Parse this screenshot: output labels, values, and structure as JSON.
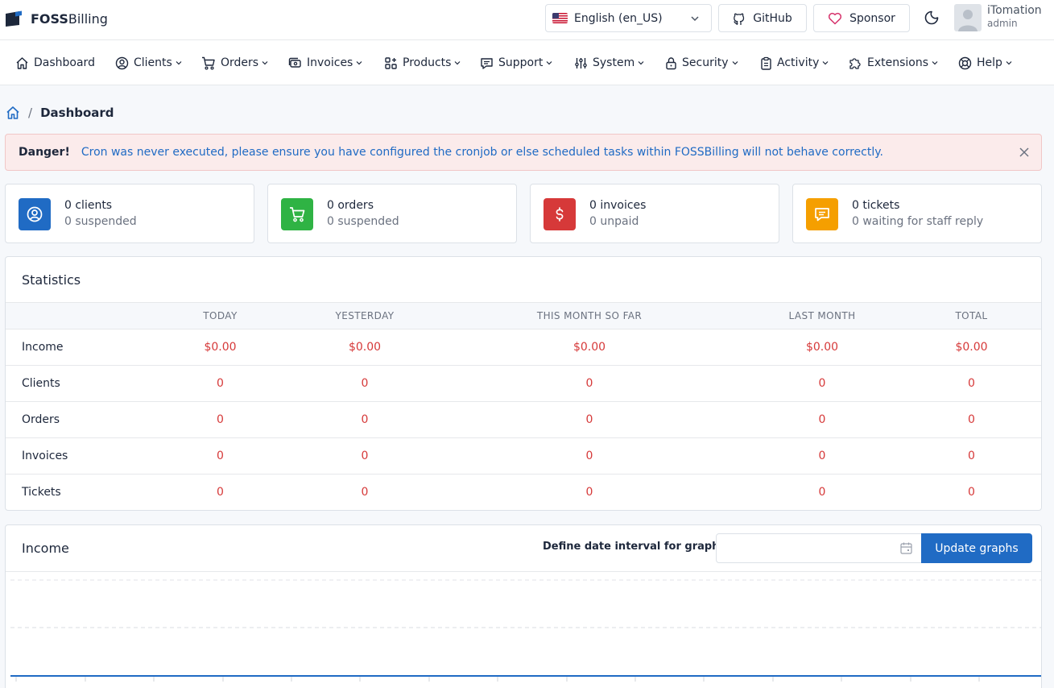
{
  "brand": {
    "bold": "FOSS",
    "rest": "Billing"
  },
  "topbar": {
    "language": "English (en_US)",
    "github_label": "GitHub",
    "sponsor_label": "Sponsor",
    "user_name": "iTomation",
    "user_role": "admin"
  },
  "nav": {
    "items": [
      {
        "label": "Dashboard",
        "icon": "home-icon"
      },
      {
        "label": "Clients",
        "icon": "user-circle-icon"
      },
      {
        "label": "Orders",
        "icon": "cart-icon"
      },
      {
        "label": "Invoices",
        "icon": "invoice-icon"
      },
      {
        "label": "Products",
        "icon": "apps-icon"
      },
      {
        "label": "Support",
        "icon": "message-icon"
      },
      {
        "label": "System",
        "icon": "adjustments-icon"
      },
      {
        "label": "Security",
        "icon": "lock-icon"
      },
      {
        "label": "Activity",
        "icon": "clipboard-icon"
      },
      {
        "label": "Extensions",
        "icon": "puzzle-icon"
      },
      {
        "label": "Help",
        "icon": "lifebuoy-icon"
      }
    ]
  },
  "breadcrumb": {
    "separator": "/",
    "current": "Dashboard"
  },
  "alert": {
    "title": "Danger!",
    "message": "Cron was never executed, please ensure you have configured the cronjob or else scheduled tasks within FOSSBilling will not behave correctly."
  },
  "summary": [
    {
      "line1": "0 clients",
      "line2": "0 suspended",
      "icon": "user-circle-icon",
      "color": "#206bc4"
    },
    {
      "line1": "0 orders",
      "line2": "0 suspended",
      "icon": "cart-icon",
      "color": "#2fb344"
    },
    {
      "line1": "0 invoices",
      "line2": "0 unpaid",
      "icon": "dollar-icon",
      "color": "#d63939"
    },
    {
      "line1": "0 tickets",
      "line2": "0 waiting for staff reply",
      "icon": "message-icon",
      "color": "#f59f00"
    }
  ],
  "statistics": {
    "title": "Statistics",
    "columns": [
      "",
      "Today",
      "Yesterday",
      "This month so far",
      "Last month",
      "Total"
    ],
    "rows": [
      {
        "label": "Income",
        "values": [
          "$0.00",
          "$0.00",
          "$0.00",
          "$0.00",
          "$0.00"
        ]
      },
      {
        "label": "Clients",
        "values": [
          "0",
          "0",
          "0",
          "0",
          "0"
        ]
      },
      {
        "label": "Orders",
        "values": [
          "0",
          "0",
          "0",
          "0",
          "0"
        ]
      },
      {
        "label": "Invoices",
        "values": [
          "0",
          "0",
          "0",
          "0",
          "0"
        ]
      },
      {
        "label": "Tickets",
        "values": [
          "0",
          "0",
          "0",
          "0",
          "0"
        ]
      }
    ]
  },
  "income": {
    "title": "Income",
    "interval_label": "Define date interval for graphs",
    "date_value": "",
    "update_button": "Update graphs"
  },
  "colors": {
    "primary": "#206bc4",
    "danger": "#d63939",
    "success": "#2fb344",
    "warning": "#f59f00"
  }
}
